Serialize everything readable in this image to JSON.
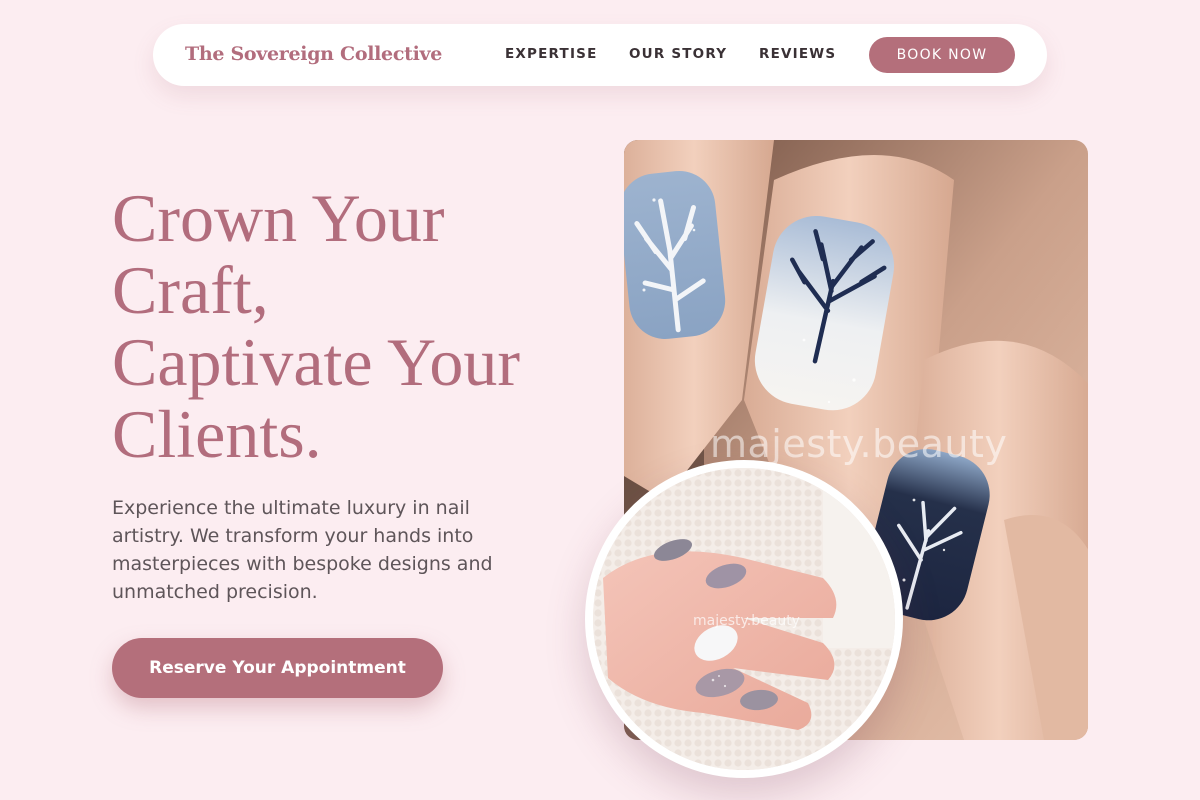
{
  "nav": {
    "brand": "The Sovereign Collective",
    "links": [
      "EXPERTISE",
      "OUR STORY",
      "REVIEWS"
    ],
    "cta_label": "BOOK NOW"
  },
  "hero": {
    "headline_lines": [
      "Crown Your",
      "Craft,",
      "Captivate Your",
      "Clients."
    ],
    "subtext": "Experience the ultimate luxury in nail artistry. We transform your hands into masterpieces with bespoke designs and unmatched precision.",
    "cta_label": "Reserve Your Appointment"
  },
  "images": {
    "main_watermark": "majesty.beauty",
    "inset_watermark": "majesty.beauty"
  },
  "colors": {
    "background": "#fcedf1",
    "accent": "#b46f7b",
    "brand_text": "#b26d7d",
    "body_text": "#5e5559"
  }
}
